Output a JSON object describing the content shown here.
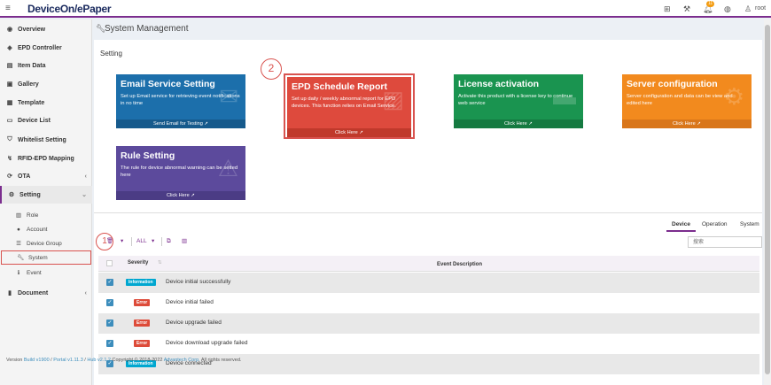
{
  "app": {
    "logo": "DeviceOn/ePaper",
    "user": "root",
    "notifications": "11"
  },
  "sidebar": {
    "items": [
      {
        "label": "Overview",
        "icon": "dashboard-icon"
      },
      {
        "label": "EPD Controller",
        "icon": "tag-icon"
      },
      {
        "label": "Item Data",
        "icon": "database-icon"
      },
      {
        "label": "Gallery",
        "icon": "image-icon"
      },
      {
        "label": "Template",
        "icon": "template-icon"
      },
      {
        "label": "Device List",
        "icon": "monitor-icon"
      },
      {
        "label": "Whitelist Setting",
        "icon": "shield-icon"
      },
      {
        "label": "RFID-EPD Mapping",
        "icon": "link-icon"
      },
      {
        "label": "OTA",
        "icon": "refresh-icon"
      },
      {
        "label": "Setting",
        "icon": "gears-icon"
      }
    ],
    "sub_items": [
      {
        "label": "Role",
        "icon": "id-card-icon"
      },
      {
        "label": "Account",
        "icon": "user-icon"
      },
      {
        "label": "Device Group",
        "icon": "list-icon"
      },
      {
        "label": "System",
        "icon": "wrench-icon"
      },
      {
        "label": "Event",
        "icon": "info-icon"
      }
    ],
    "document": {
      "label": "Document",
      "icon": "book-icon"
    }
  },
  "header": {
    "title": "System Management"
  },
  "setting": {
    "title": "Setting",
    "cards": [
      {
        "title": "Email Service Setting",
        "desc": "Set up Email service for retrieving event notifications in no time",
        "action": "Send Email for Testing"
      },
      {
        "title": "EPD Schedule Report",
        "desc": "Set up daily / weekly abnormal report for EPD devices. This function relies on Email Service.",
        "action": "Click Here"
      },
      {
        "title": "License activation",
        "desc": "Activate this product with a license key to continue web service",
        "action": "Click Here"
      },
      {
        "title": "Server configuration",
        "desc": "Server configuration and data can be view and edited here",
        "action": "Click Here"
      },
      {
        "title": "Rule Setting",
        "desc": "The rule for device abnormal warning can be setted here",
        "action": "Click Here"
      }
    ]
  },
  "annotations": {
    "one": "1",
    "two": "2"
  },
  "events": {
    "tabs": [
      "Device",
      "Operation",
      "System"
    ],
    "filter_all": "ALL",
    "search_placeholder": "搜索",
    "headers": {
      "severity": "Severity",
      "description": "Event Description"
    },
    "rows": [
      {
        "severity": "Information",
        "level": "info",
        "desc": "Device initial successfully"
      },
      {
        "severity": "Error",
        "level": "err",
        "desc": "Device initial failed"
      },
      {
        "severity": "Error",
        "level": "err",
        "desc": "Device upgrade failed"
      },
      {
        "severity": "Error",
        "level": "err",
        "desc": "Device download upgrade failed"
      },
      {
        "severity": "Information",
        "level": "info",
        "desc": "Device connected"
      }
    ]
  },
  "footer": {
    "prefix": "Version",
    "build": "Build v1900",
    "portal": "Portal v1.11.3",
    "hub": "Hub v2.1.2",
    "copyright": "Copyright © 2018-2022",
    "company": "Advantech Corp.",
    "rights": "All rights reserved."
  }
}
